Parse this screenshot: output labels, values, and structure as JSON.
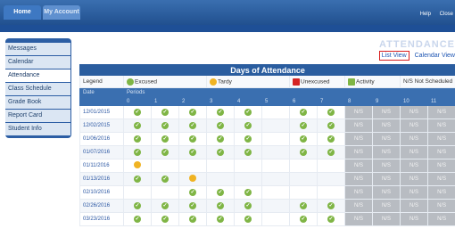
{
  "tabs": {
    "home": "Home",
    "account": "My Account"
  },
  "toplinks": {
    "help": "Help",
    "close": "Close"
  },
  "sidebar": {
    "items": [
      {
        "label": "Messages"
      },
      {
        "label": "Calendar"
      },
      {
        "label": "Attendance"
      },
      {
        "label": "Class Schedule"
      },
      {
        "label": "Grade Book"
      },
      {
        "label": "Report Card"
      },
      {
        "label": "Student Info"
      }
    ]
  },
  "page": {
    "title": "ATTENDANCE",
    "list_view": "List View",
    "calendar_view": "Calendar View"
  },
  "table": {
    "caption": "Days of Attendance",
    "legend_label": "Legend",
    "legend": {
      "excused": "Excused",
      "tardy": "Tardy",
      "unexcused": "Unexcused",
      "activity": "Activity",
      "not_scheduled": "N/S Not Scheduled"
    },
    "date_header": "Date",
    "periods_header": "Periods",
    "periods": [
      "0",
      "1",
      "2",
      "3",
      "4",
      "5",
      "6",
      "7",
      "8",
      "9",
      "10",
      "11"
    ],
    "ns_text": "N/S",
    "rows": [
      {
        "date": "12/01/2015",
        "marks": [
          "x",
          "x",
          "x",
          "x",
          "x",
          "",
          "x",
          "x",
          "ns",
          "ns",
          "ns",
          "ns"
        ]
      },
      {
        "date": "12/02/2015",
        "marks": [
          "x",
          "x",
          "x",
          "x",
          "x",
          "",
          "x",
          "x",
          "ns",
          "ns",
          "ns",
          "ns"
        ]
      },
      {
        "date": "01/06/2016",
        "marks": [
          "x",
          "x",
          "x",
          "x",
          "x",
          "",
          "x",
          "x",
          "ns",
          "ns",
          "ns",
          "ns"
        ]
      },
      {
        "date": "01/07/2016",
        "marks": [
          "x",
          "x",
          "x",
          "x",
          "x",
          "",
          "x",
          "x",
          "ns",
          "ns",
          "ns",
          "ns"
        ]
      },
      {
        "date": "01/11/2016",
        "marks": [
          "t",
          "",
          "",
          "",
          "",
          "",
          "",
          "",
          "ns",
          "ns",
          "ns",
          "ns"
        ]
      },
      {
        "date": "01/13/2016",
        "marks": [
          "x",
          "x",
          "t",
          "",
          "",
          "",
          "",
          "",
          "ns",
          "ns",
          "ns",
          "ns"
        ]
      },
      {
        "date": "02/10/2016",
        "marks": [
          "",
          "",
          "x",
          "x",
          "x",
          "",
          "",
          "",
          "ns",
          "ns",
          "ns",
          "ns"
        ]
      },
      {
        "date": "02/26/2016",
        "marks": [
          "x",
          "x",
          "x",
          "x",
          "x",
          "",
          "x",
          "x",
          "ns",
          "ns",
          "ns",
          "ns"
        ]
      },
      {
        "date": "03/23/2016",
        "marks": [
          "x",
          "x",
          "x",
          "x",
          "x",
          "",
          "x",
          "x",
          "ns",
          "ns",
          "ns",
          "ns"
        ]
      }
    ]
  },
  "colors": {
    "brand": "#2a5d9f",
    "excused": "#7fb545",
    "tardy": "#f0b323",
    "unexcused": "#d52424",
    "not_scheduled": "#b8bcc2"
  }
}
